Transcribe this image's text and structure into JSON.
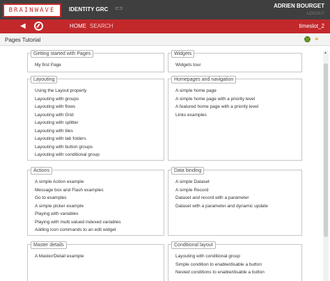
{
  "header": {
    "logo": "BRAINWAVE",
    "app_title": "IDENTITY GRC",
    "app_icon": "chain-link-icon",
    "user_name": "ADRIEN BOURGET",
    "logout": "LOGOUT"
  },
  "nav": {
    "home": "HOME",
    "search": "SEARCH",
    "timeslot": "timeslot_2"
  },
  "page": {
    "title": "Pages Tutorial"
  },
  "groups": {
    "getting_started": {
      "title": "Getting started with Pages",
      "items": [
        "My first Page"
      ]
    },
    "widgets": {
      "title": "Widgets",
      "items": [
        "Widgets tour"
      ]
    },
    "layouting": {
      "title": "Layouting",
      "items": [
        "Using the Layout property",
        "Layouting with groups",
        "Layouting with flows",
        "Layouting with Grid",
        "Layouting with splitter",
        "Layouting with tiles",
        "Layouting with tab folders",
        "Layouting with button groups",
        "Layouting with conditional group"
      ]
    },
    "homepages": {
      "title": "Homepages and navigation",
      "items": [
        "A simple home page",
        "A simple home page with a priority level",
        "A featured home page with a priority level",
        "Links examples"
      ]
    },
    "actions": {
      "title": "Actions",
      "items": [
        "A simple Action example",
        "Message box and Flash examples",
        "Go to examples",
        "A simple picker example",
        "Playing with variables",
        "Playing with multi valued indexed variables",
        "Adding icon commands to an edit widget"
      ]
    },
    "data_binding": {
      "title": "Data binding",
      "items": [
        "A simple Dataset",
        "A simple Record",
        "Dataset and record with a parameter",
        "Dataset with a parameter and dynamic update"
      ]
    },
    "master_details": {
      "title": "Master details",
      "items": [
        "A Master/Detail example"
      ]
    },
    "conditional_layout": {
      "title": "Conditional layout",
      "items": [
        "Layouting with conditional group",
        "Simple condition to enable/disable a button",
        "Nested conditions to enable/disable a button"
      ]
    }
  },
  "colors": {
    "topbar": "#3f3f3f",
    "navbar": "#c3282b",
    "brand": "#c42a2a"
  }
}
